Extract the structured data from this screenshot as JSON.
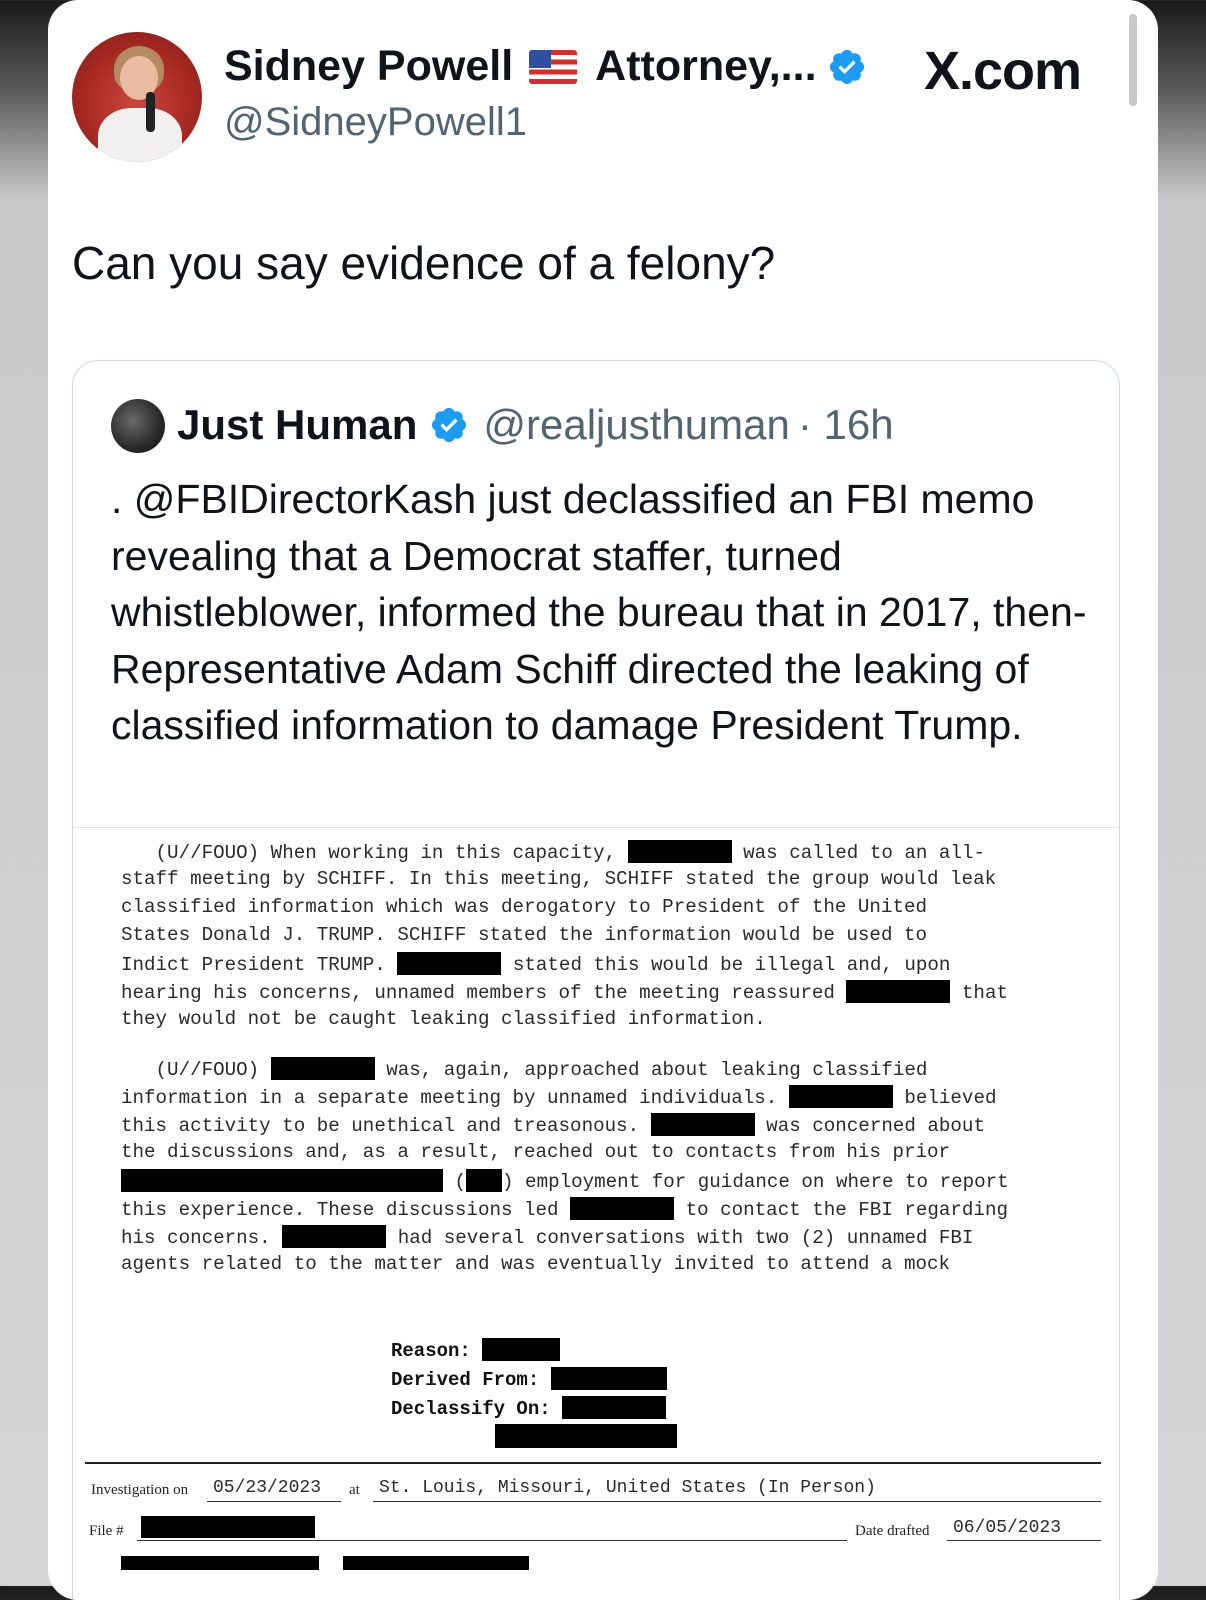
{
  "post": {
    "author_name": "Sidney Powell",
    "author_title": "Attorney,...",
    "author_handle": "@SidneyPowell1",
    "site_label": "X.com",
    "text": "Can you say evidence of a felony?"
  },
  "quoted_post": {
    "author_name": "Just Human",
    "author_handle": "@realjusthuman",
    "time": "· 16h",
    "text": ". @FBIDirectorKash just declassified an FBI memo revealing that a Democrat staffer, turned whistleblower, informed the bureau that in 2017, then-Representative Adam Schiff directed the leaking of classified information to damage President Trump."
  },
  "document": {
    "p1": {
      "l1a": "   (U//FOUO) When working in this capacity, ",
      "l1b": " was called to an all-",
      "l2": "staff meeting by SCHIFF. In this meeting, SCHIFF stated the group would leak",
      "l3": "classified information which was derogatory to President of the United",
      "l4": "States Donald J. TRUMP. SCHIFF stated the information would be used to",
      "l5a": "Indict President TRUMP. ",
      "l5b": " stated this would be illegal and, upon",
      "l6a": "hearing his concerns, unnamed members of the meeting reassured ",
      "l6b": " that",
      "l7": "they would not be caught leaking classified information."
    },
    "p2": {
      "l1a": "   (U//FOUO) ",
      "l1b": " was, again, approached about leaking classified",
      "l2a": "information in a separate meeting by unnamed individuals. ",
      "l2b": " believed",
      "l3a": "this activity to be unethical and treasonous. ",
      "l3b": " was concerned about",
      "l4": "the discussions and, as a result, reached out to contacts from his prior",
      "l5a": " (",
      "l5b": ") employment for guidance on where to report",
      "l6a": "this experience. These discussions led ",
      "l6b": " to contact the FBI regarding",
      "l7a": "his concerns. ",
      "l7b": " had several conversations with two (2) unnamed FBI",
      "l8": "agents related to the matter and was eventually invited to attend a mock"
    },
    "classification": {
      "reason": "Reason:",
      "derived_from": "Derived From:",
      "declassify_on": "Declassify On:"
    },
    "footer": {
      "investigation_label": "Investigation on",
      "investigation_date": "05/23/2023",
      "at_label": "at",
      "location": "St. Louis, Missouri, United States (In Person)",
      "file_label": "File #",
      "date_drafted_label": "Date drafted",
      "date_drafted": "06/05/2023"
    }
  },
  "colors": {
    "verified_blue": "#1d9bf0",
    "text_primary": "#0f1419",
    "text_secondary": "#536471",
    "redaction": "#000000"
  }
}
